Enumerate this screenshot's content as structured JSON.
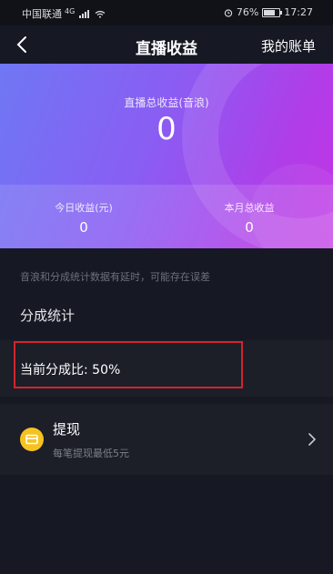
{
  "status_bar": {
    "carrier": "中国联通",
    "network": "4G",
    "battery": "76%",
    "battery_level": 0.76,
    "time": "17:27"
  },
  "nav": {
    "title": "直播收益",
    "right_link": "我的账单"
  },
  "summary": {
    "total_label": "直播总收益(音浪)",
    "total_value": "0",
    "today_label": "今日收益(元)",
    "today_value": "0",
    "month_label": "本月总收益",
    "month_value": "0"
  },
  "note": "音浪和分成统计数据有延时，可能存在误差",
  "share": {
    "section_title": "分成统计",
    "current_ratio": "当前分成比: 50%"
  },
  "withdraw": {
    "title": "提现",
    "subtitle": "每笔提现最低5元"
  },
  "colors": {
    "background": "#161823",
    "row_background": "#1c1e28",
    "gradient_start": "#6f77f4",
    "gradient_end": "#c235e6",
    "highlight": "#d3242c",
    "coin": "#f5c321"
  }
}
